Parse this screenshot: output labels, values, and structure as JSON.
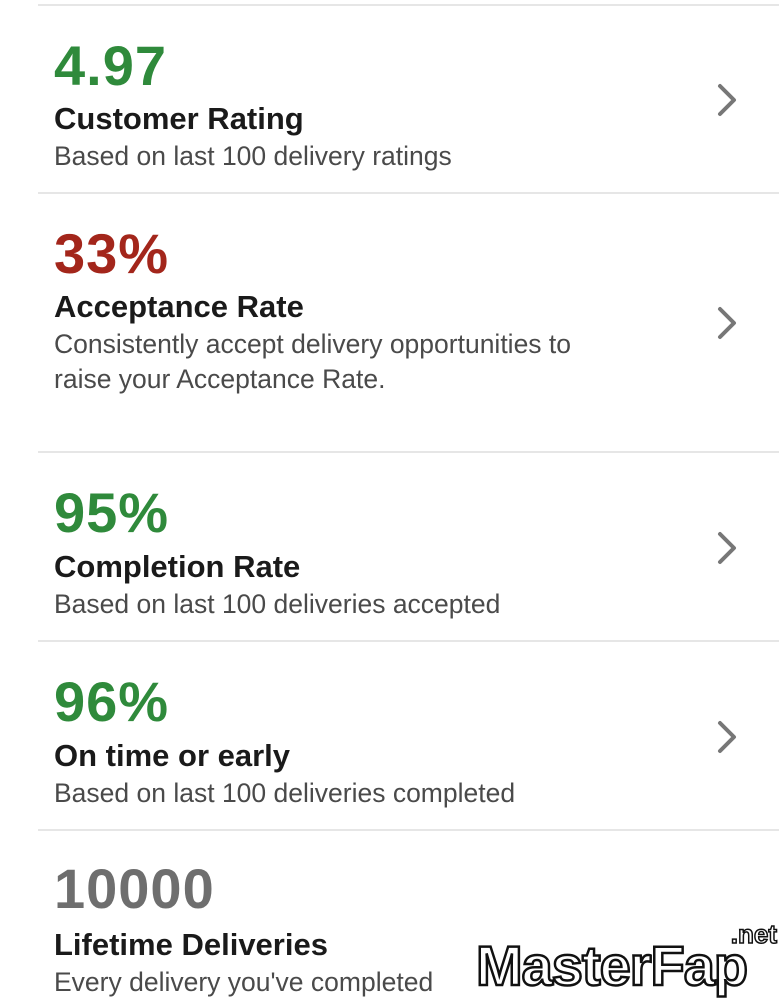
{
  "colors": {
    "good": "#2f8a3b",
    "bad": "#a3261b",
    "neutral": "#6e6e6e",
    "chevron": "#777777"
  },
  "metrics": [
    {
      "value": "4.97",
      "status": "good",
      "title": "Customer Rating",
      "description": "Based on last 100 delivery ratings",
      "icon": "chevron-right-icon"
    },
    {
      "value": "33%",
      "status": "bad",
      "title": "Acceptance Rate",
      "description": "Consistently accept delivery opportunities to raise your Acceptance Rate.",
      "icon": "chevron-right-icon"
    },
    {
      "value": "95%",
      "status": "good",
      "title": "Completion Rate",
      "description": "Based on last 100 deliveries accepted",
      "icon": "chevron-right-icon"
    },
    {
      "value": "96%",
      "status": "good",
      "title": "On time or early",
      "description": "Based on last 100 deliveries completed",
      "icon": "chevron-right-icon"
    },
    {
      "value": "10000",
      "status": "neutral",
      "title": "Lifetime Deliveries",
      "description": "Every delivery you've completed",
      "icon": null
    }
  ],
  "watermark": {
    "text_master": "Master",
    "text_fap": "Fap",
    "suffix": ".net"
  }
}
